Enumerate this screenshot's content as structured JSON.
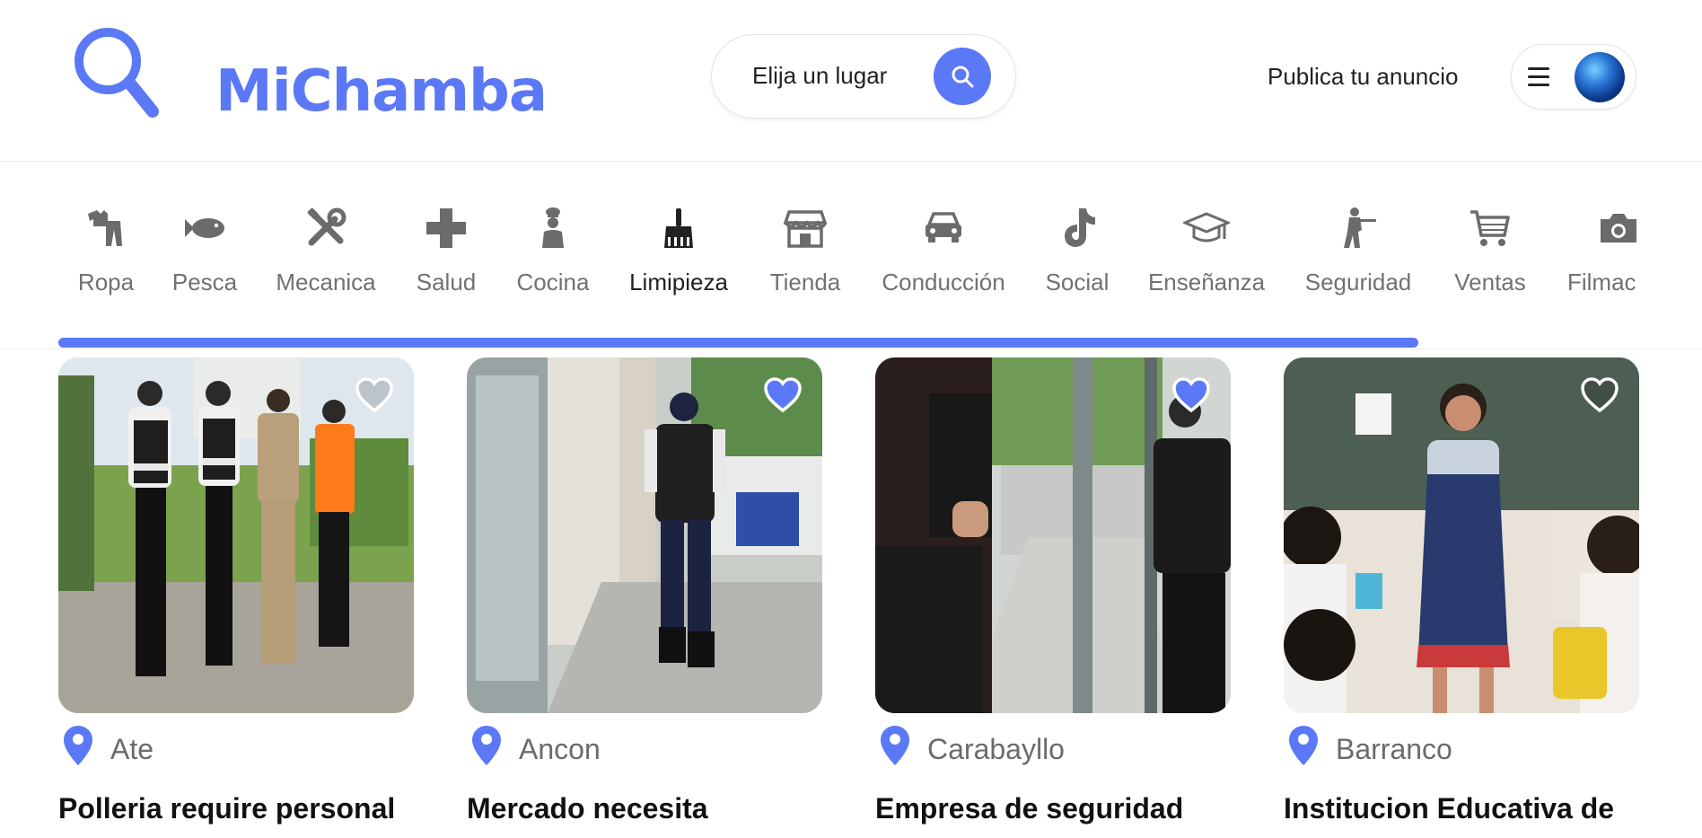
{
  "brand": {
    "name": "MiChamba",
    "accent": "#5b78f6"
  },
  "search": {
    "placeholder": "Elija un lugar"
  },
  "nav": {
    "publish_label": "Publica tu anuncio"
  },
  "categories": [
    {
      "label": "Ropa",
      "icon": "clothes-icon"
    },
    {
      "label": "Pesca",
      "icon": "fish-icon"
    },
    {
      "label": "Mecanica",
      "icon": "tools-icon"
    },
    {
      "label": "Salud",
      "icon": "health-cross-icon"
    },
    {
      "label": "Cocina",
      "icon": "chef-icon"
    },
    {
      "label": "Limipieza",
      "icon": "broom-icon",
      "active": true
    },
    {
      "label": "Tienda",
      "icon": "store-icon"
    },
    {
      "label": "Conducción",
      "icon": "car-icon"
    },
    {
      "label": "Social",
      "icon": "tiktok-icon"
    },
    {
      "label": "Enseñanza",
      "icon": "graduation-cap-icon"
    },
    {
      "label": "Seguridad",
      "icon": "soldier-icon"
    },
    {
      "label": "Ventas",
      "icon": "cart-icon"
    },
    {
      "label": "Filmac",
      "icon": "camera-icon"
    }
  ],
  "listings": [
    {
      "location": "Ate",
      "title": "Polleria require personal",
      "favorited": false,
      "photo": "security-guards-group"
    },
    {
      "location": "Ancon",
      "title": "Mercado necesita",
      "favorited": true,
      "photo": "guard-walking-sidewalk"
    },
    {
      "location": "Carabayllo",
      "title": "Empresa de seguridad",
      "favorited": true,
      "photo": "guards-on-street"
    },
    {
      "location": "Barranco",
      "title": "Institucion Educativa de",
      "favorited": false,
      "photo": "teacher-classroom"
    }
  ]
}
